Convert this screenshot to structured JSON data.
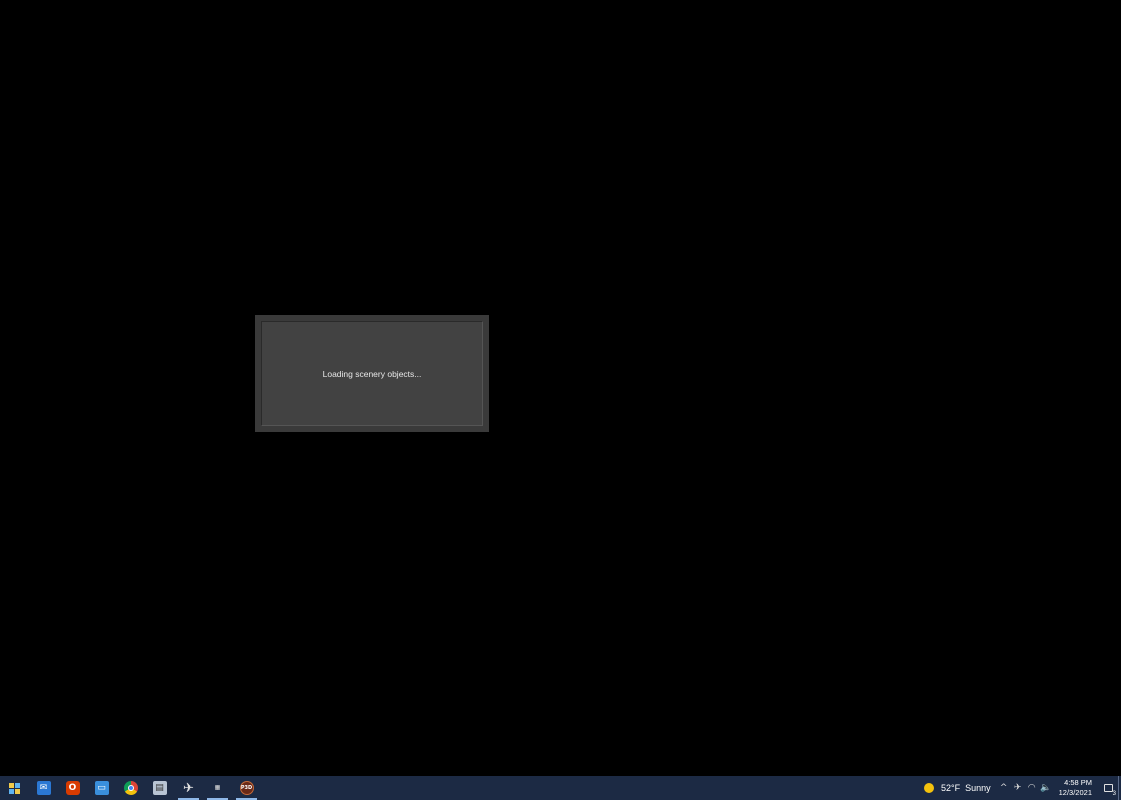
{
  "dialog": {
    "message": "Loading scenery objects..."
  },
  "taskbar": {
    "apps": [
      {
        "name": "start",
        "icon": "windows-logo-icon"
      },
      {
        "name": "mail",
        "icon": "mail-icon"
      },
      {
        "name": "office",
        "icon": "office-icon",
        "glyph": "O"
      },
      {
        "name": "explorer",
        "icon": "explorer-icon"
      },
      {
        "name": "chrome",
        "icon": "chrome-icon"
      },
      {
        "name": "files",
        "icon": "files-icon"
      },
      {
        "name": "drone",
        "icon": "drone-icon",
        "glyph": "✈",
        "active": true
      },
      {
        "name": "sim-app",
        "icon": "sim-app-icon",
        "active": true
      },
      {
        "name": "p3d",
        "icon": "p3d-icon",
        "glyph": "P3D",
        "active": true
      }
    ],
    "weather": {
      "temp": "52°F",
      "condition": "Sunny"
    },
    "tray_icons": {
      "chevron": "^",
      "drone": "✈",
      "network": "◠",
      "volume": "🔈"
    },
    "clock": {
      "time": "4:58 PM",
      "date": "12/3/2021"
    },
    "notifications": {
      "count": "3"
    }
  },
  "colors": {
    "desktop": "#000000",
    "taskbar": "#1c2a44",
    "dialog_outer": "#3a3a3a",
    "dialog_inner": "#424242"
  }
}
